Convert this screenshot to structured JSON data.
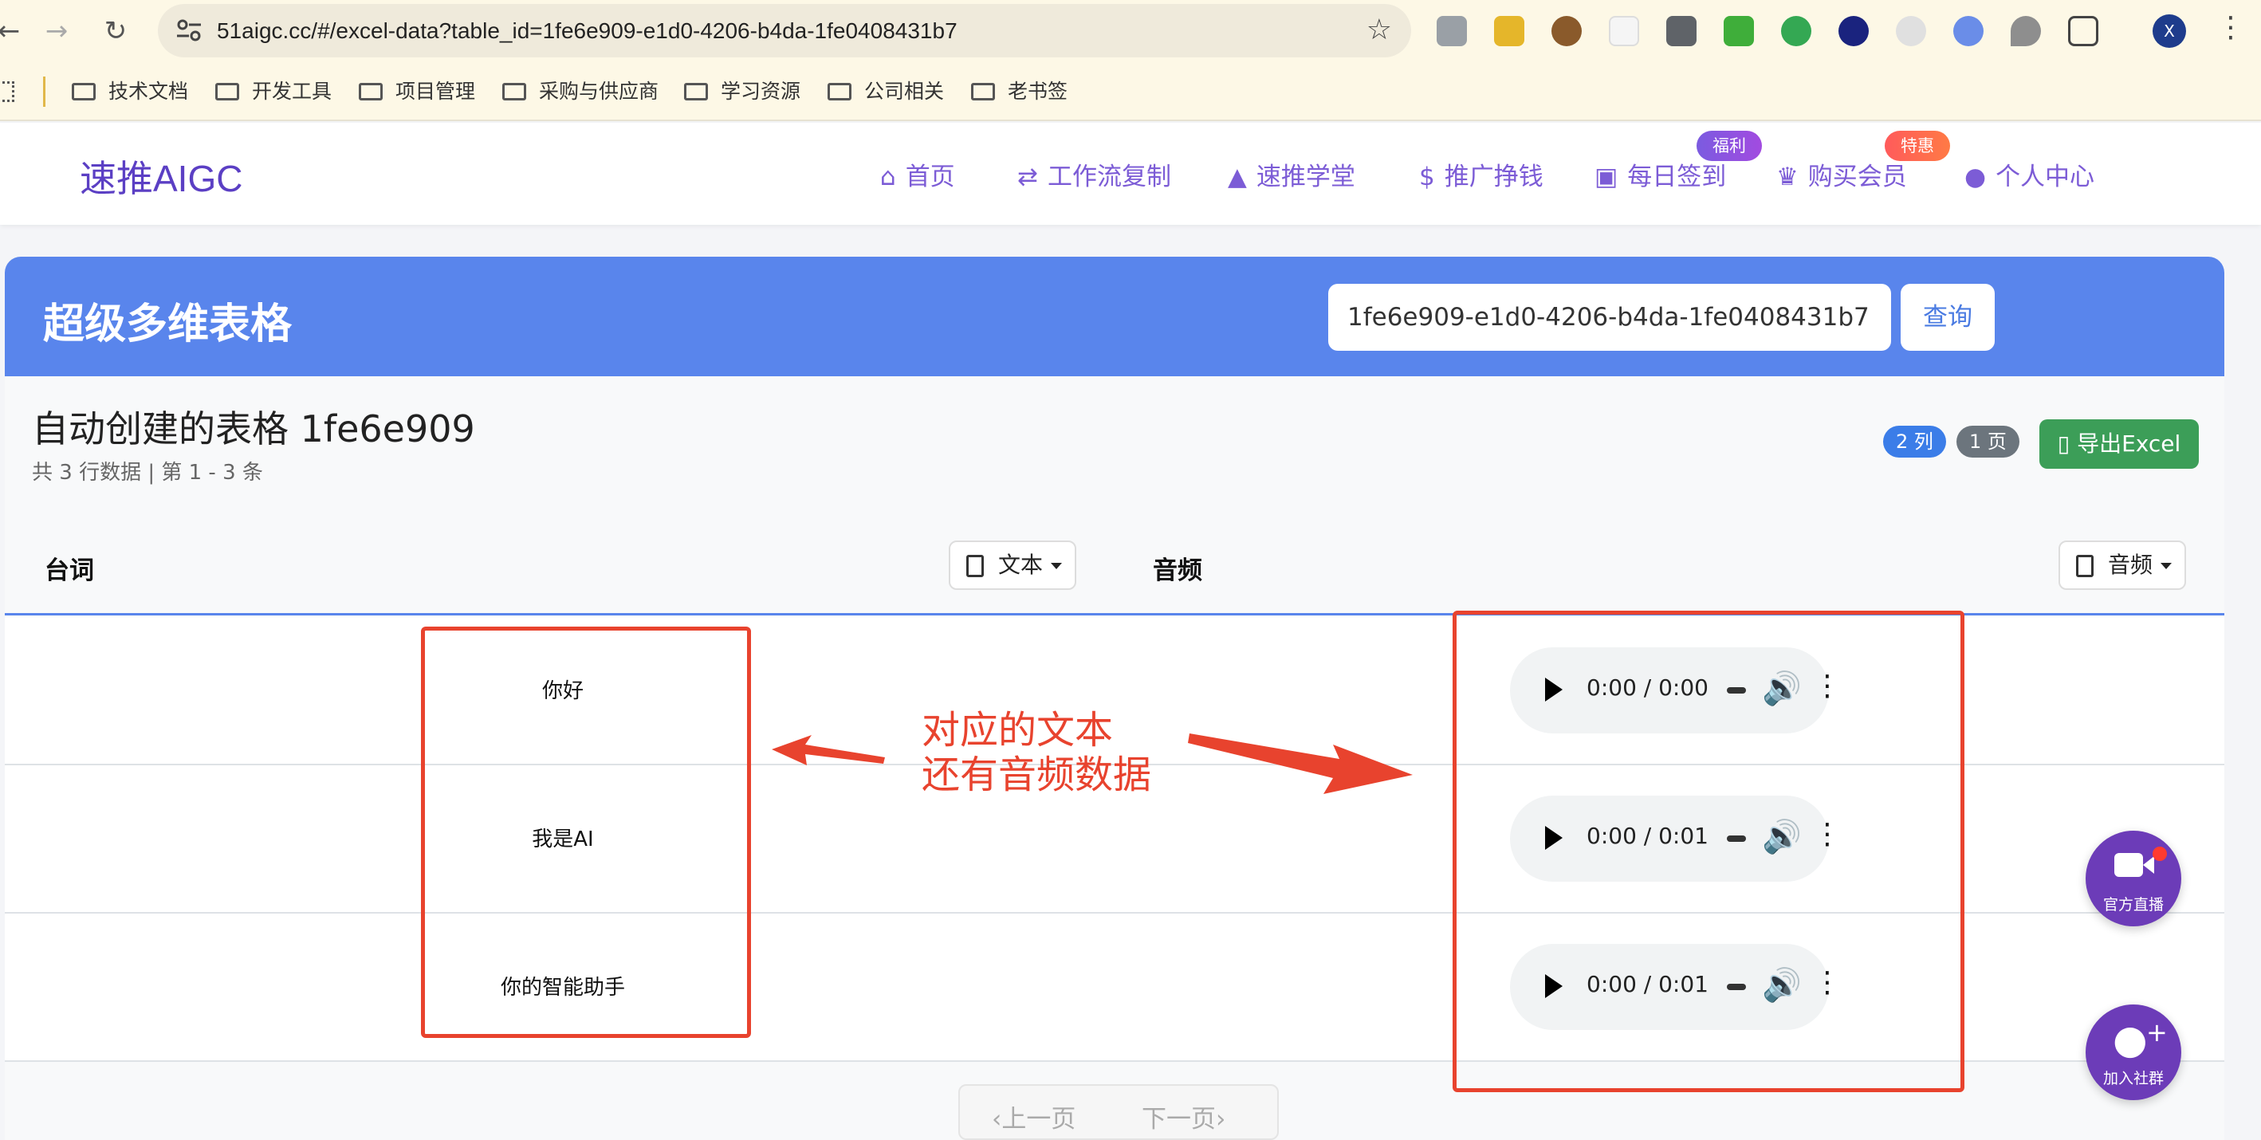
{
  "browser": {
    "url": "51aigc.cc/#/excel-data?table_id=1fe6e909-e1d0-4206-b4da-1fe0408431b7",
    "bookmarks": [
      "技术文档",
      "开发工具",
      "项目管理",
      "采购与供应商",
      "学习资源",
      "公司相关",
      "老书签"
    ],
    "profile_initial": "X"
  },
  "site": {
    "logo": "速推AIGC",
    "nav": [
      {
        "label": "首页",
        "icon": "home-icon"
      },
      {
        "label": "工作流复制",
        "icon": "swap-arrows-icon"
      },
      {
        "label": "速推学堂",
        "icon": "graduation-cap-icon"
      },
      {
        "label": "推广挣钱",
        "icon": "dollar-icon"
      },
      {
        "label": "每日签到",
        "icon": "calendar-check-icon"
      },
      {
        "label": "购买会员",
        "icon": "crown-icon"
      },
      {
        "label": "个人中心",
        "icon": "user-icon"
      }
    ],
    "badges": {
      "checkin": "福利",
      "membership": "特惠"
    }
  },
  "banner": {
    "title": "超级多维表格",
    "table_id_value": "1fe6e909-e1d0-4206-b4da-1fe0408431b7",
    "query_label": "查询"
  },
  "table": {
    "title": "自动创建的表格 1fe6e909",
    "subtitle": "共 3 行数据 | 第 1 - 3 条",
    "columns_badge": "2 列",
    "pages_badge": "1 页",
    "export_label": "导出Excel",
    "columns": [
      {
        "label": "台词",
        "type_label": "文本"
      },
      {
        "label": "音频",
        "type_label": "音频"
      }
    ],
    "rows": [
      {
        "text": "你好",
        "audio_time": "0:00 / 0:00"
      },
      {
        "text": "我是AI",
        "audio_time": "0:00 / 0:01"
      },
      {
        "text": "你的智能助手",
        "audio_time": "0:00 / 0:01"
      }
    ],
    "pager": {
      "prev": "上一页",
      "next": "下一页"
    }
  },
  "fabs": {
    "live": "官方直播",
    "community": "加入社群"
  },
  "annotation": {
    "line1": "对应的文本",
    "line2": "还有音频数据"
  },
  "colors": {
    "accent": "#5985ec",
    "brand": "#7c5cd6",
    "annotation": "#e8432e",
    "export": "#3c9e58"
  }
}
